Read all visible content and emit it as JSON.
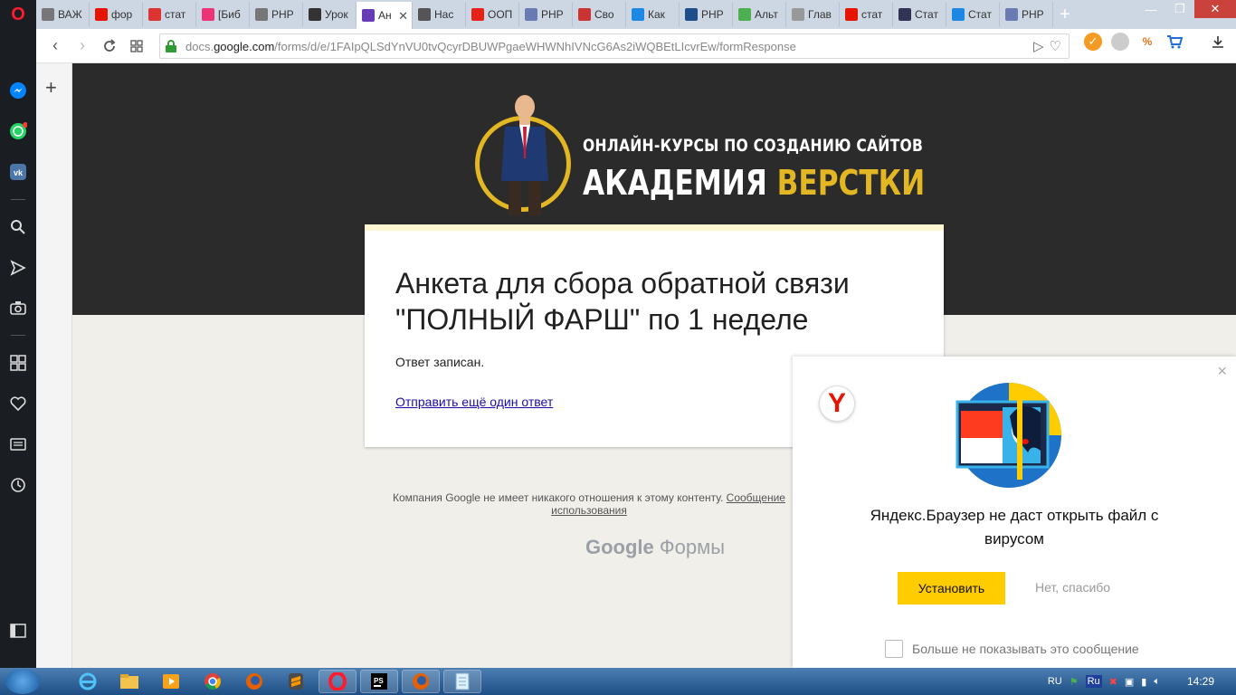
{
  "tabs": [
    {
      "title": "ВАЖ",
      "icon": "doc-icon",
      "color": "#777777"
    },
    {
      "title": "фор",
      "icon": "yandex-icon",
      "color": "#e61400"
    },
    {
      "title": "стат",
      "icon": "chart-icon",
      "color": "#d33"
    },
    {
      "title": "[Биб",
      "icon": "color-wheel-icon",
      "color": "#e37"
    },
    {
      "title": "PHP",
      "icon": "doc-icon",
      "color": "#777777"
    },
    {
      "title": "Урок",
      "icon": "gc-icon",
      "color": "#333"
    },
    {
      "title": "Ан",
      "icon": "google-forms-icon",
      "color": "#673ab7",
      "active": true
    },
    {
      "title": "Нас",
      "icon": "mail-icon",
      "color": "#555"
    },
    {
      "title": "ООП",
      "icon": "youtube-icon",
      "color": "#e62117"
    },
    {
      "title": "PHP",
      "icon": "php-icon",
      "color": "#6a7bb4"
    },
    {
      "title": "Сво",
      "icon": "code-icon",
      "color": "#c33"
    },
    {
      "title": "Как",
      "icon": "tz-icon",
      "color": "#1e88e5"
    },
    {
      "title": "PHP",
      "icon": "k-icon",
      "color": "#1e4e8c"
    },
    {
      "title": "Альт",
      "icon": "puzzle-icon",
      "color": "#4caf50"
    },
    {
      "title": "Глав",
      "icon": "diamond-icon",
      "color": "#999"
    },
    {
      "title": "стат",
      "icon": "yandex-icon",
      "color": "#e61400"
    },
    {
      "title": "Стат",
      "icon": "eye-icon",
      "color": "#335"
    },
    {
      "title": "Стат",
      "icon": "m-icon",
      "color": "#1e88e5"
    },
    {
      "title": "PHP",
      "icon": "php-icon",
      "color": "#6a7bb4"
    }
  ],
  "window_controls": {
    "minimize": "—",
    "maximize": "❐",
    "close": "✕"
  },
  "address": {
    "prefix": "docs.",
    "domain": "google.com",
    "path": "/forms/d/e/1FAIpQLSdYnVU0tvQcyrDBUWPgaeWHWNhIVNcG6As2iWQBEtLIcvrEw/formResponse"
  },
  "logo": {
    "subtitle": "ОНЛАЙН-КУРСЫ ПО СОЗДАНИЮ САЙТОВ",
    "main_word1": "АКАДЕМИЯ",
    "main_word2": "ВЕРСТКИ"
  },
  "form": {
    "title": "Анкета для сбора обратной связи \"ПОЛНЫЙ ФАРШ\" по 1 неделе",
    "confirmation": "Ответ записан.",
    "another_response_link": "Отправить ещё один ответ"
  },
  "footer": {
    "disclaimer": "Компания Google не имеет никакого отношения к этому контенту. ",
    "report_link_part1": "Сообщение",
    "report_link_part2": "использования",
    "brand_google": "Google",
    "brand_forms": "Формы"
  },
  "yandex_popup": {
    "message": "Яндекс.Браузер не даст открыть файл с вирусом",
    "install_button": "Установить",
    "decline_button": "Нет, спасибо",
    "dont_show_label": "Больше не показывать это сообщение",
    "close": "×",
    "logo_letter": "Y"
  },
  "taskbar": {
    "language": "RU",
    "keyboard": "Ru",
    "time": "14:29"
  }
}
